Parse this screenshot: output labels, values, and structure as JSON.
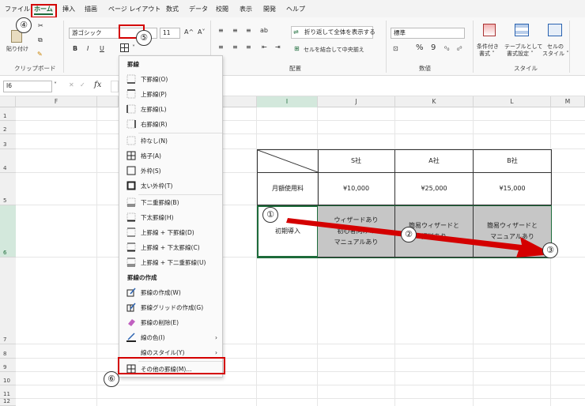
{
  "menubar": {
    "tabs": [
      "ファイル",
      "ホーム",
      "挿入",
      "描画",
      "ページ レイアウト",
      "数式",
      "データ",
      "校閲",
      "表示",
      "開発",
      "ヘルプ"
    ]
  },
  "ribbon": {
    "clipboard": {
      "paste": "貼り付け",
      "group": "クリップボード"
    },
    "font": {
      "name": "游ゴシック",
      "size": "11",
      "grow": "A^",
      "shrink": "A˅",
      "bold": "B",
      "italic": "I",
      "underline": "U"
    },
    "alignment": {
      "wrap": "折り返して全体を表示する",
      "merge": "セルを結合して中央揃え",
      "group": "配置"
    },
    "number": {
      "format": "標準",
      "group": "数値",
      "percent": "%",
      "comma": "9"
    },
    "styles": {
      "cond": [
        "条件付き",
        "書式 ˅"
      ],
      "table": [
        "テーブルとして",
        "書式設定 ˅"
      ],
      "cell": [
        "セルの",
        "スタイル ˅"
      ],
      "group": "スタイル"
    }
  },
  "formula_bar": {
    "name_box": "I6",
    "fx": "fx"
  },
  "columns": [
    "F",
    "I",
    "J",
    "K",
    "L",
    "M"
  ],
  "rows": [
    "1",
    "2",
    "3",
    "4",
    "5",
    "6",
    "7",
    "8",
    "9",
    "10",
    "11",
    "12"
  ],
  "table": {
    "headers": [
      "S社",
      "A社",
      "B社"
    ],
    "row1": {
      "label": "月額使用料",
      "values": [
        "¥10,000",
        "¥25,000",
        "¥15,000"
      ]
    },
    "row2": {
      "label": "初期導入",
      "values": [
        [
          "ウィザードあり",
          "初心者向けの",
          "マニュアルあり"
        ],
        [
          "簡易ウィザードと",
          "資料あり"
        ],
        [
          "簡易ウィザードと",
          "マニュアルあり"
        ]
      ]
    }
  },
  "border_menu": {
    "section_title": "罫線",
    "items1": [
      "下罫線(O)",
      "上罫線(P)",
      "左罫線(L)",
      "右罫線(R)"
    ],
    "items2": [
      "枠なし(N)",
      "格子(A)",
      "外枠(S)",
      "太い外枠(T)"
    ],
    "items3": [
      "下二重罫線(B)",
      "下太罫線(H)",
      "上罫線 + 下罫線(D)",
      "上罫線 + 下太罫線(C)",
      "上罫線 + 下二重罫線(U)"
    ],
    "draw_title": "罫線の作成",
    "draw_items": [
      "罫線の作成(W)",
      "罫線グリッドの作成(G)",
      "罫線の削除(E)",
      "線の色(I)",
      "線のスタイル(Y)"
    ],
    "more": "その他の罫線(M)..."
  },
  "annotations": [
    "①",
    "②",
    "③",
    "④",
    "⑤",
    "⑥"
  ],
  "colors": {
    "accent_red": "#d40000",
    "excel_green": "#1d6b3a",
    "cell_grey": "#c6c6c6"
  }
}
